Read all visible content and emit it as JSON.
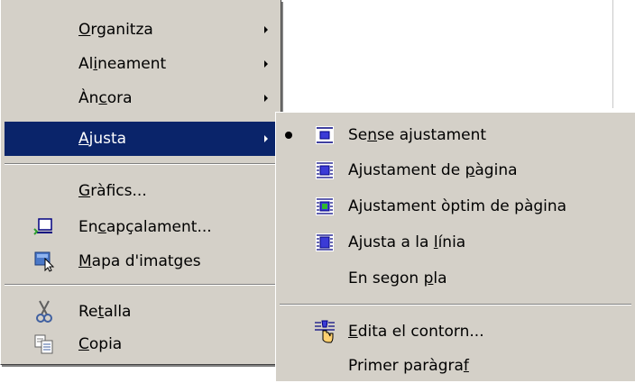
{
  "main_menu": {
    "items": [
      {
        "pre": "",
        "key": "O",
        "post": "rganitza",
        "has_submenu": true
      },
      {
        "pre": "Al",
        "key": "i",
        "post": "neament",
        "has_submenu": true
      },
      {
        "pre": "Àn",
        "key": "c",
        "post": "ora",
        "has_submenu": true
      },
      {
        "pre": "",
        "key": "A",
        "post": "justa",
        "has_submenu": true,
        "highlighted": true
      },
      {
        "pre": "",
        "key": "G",
        "post": "ràfics...",
        "has_submenu": false
      },
      {
        "pre": "En",
        "key": "c",
        "post": "apçalament...",
        "has_submenu": false,
        "icon": "header-icon"
      },
      {
        "pre": "",
        "key": "M",
        "post": "apa d'imatges",
        "has_submenu": false,
        "icon": "image-map-icon"
      },
      {
        "pre": "Re",
        "key": "t",
        "post": "alla",
        "has_submenu": false,
        "icon": "scissors-icon"
      },
      {
        "pre": "",
        "key": "C",
        "post": "opia",
        "has_submenu": false,
        "icon": "copy-icon"
      }
    ]
  },
  "sub_menu": {
    "items": [
      {
        "pre": "Se",
        "key": "n",
        "post": "se ajustament",
        "icon": "wrap-none-icon",
        "selected": true
      },
      {
        "pre": "Ajustament de ",
        "key": "p",
        "post": "àgina",
        "icon": "wrap-page-icon"
      },
      {
        "pre": "A",
        "key": "j",
        "post": "ustament òptim de pàgina",
        "icon": "wrap-optimal-icon"
      },
      {
        "pre": "Ajusta a la ",
        "key": "l",
        "post": "ínia",
        "icon": "wrap-line-icon"
      },
      {
        "pre": "En segon ",
        "key": "p",
        "post": "la",
        "icon": ""
      },
      {
        "pre": "",
        "key": "E",
        "post": "dita el contorn...",
        "icon": "edit-contour-icon"
      },
      {
        "pre": "Primer paràgra",
        "key": "f",
        "post": "",
        "icon": ""
      }
    ]
  },
  "colors": {
    "menu_bg": "#d4d0c8",
    "highlight": "#0a246a",
    "highlight_text": "#ffffff"
  }
}
